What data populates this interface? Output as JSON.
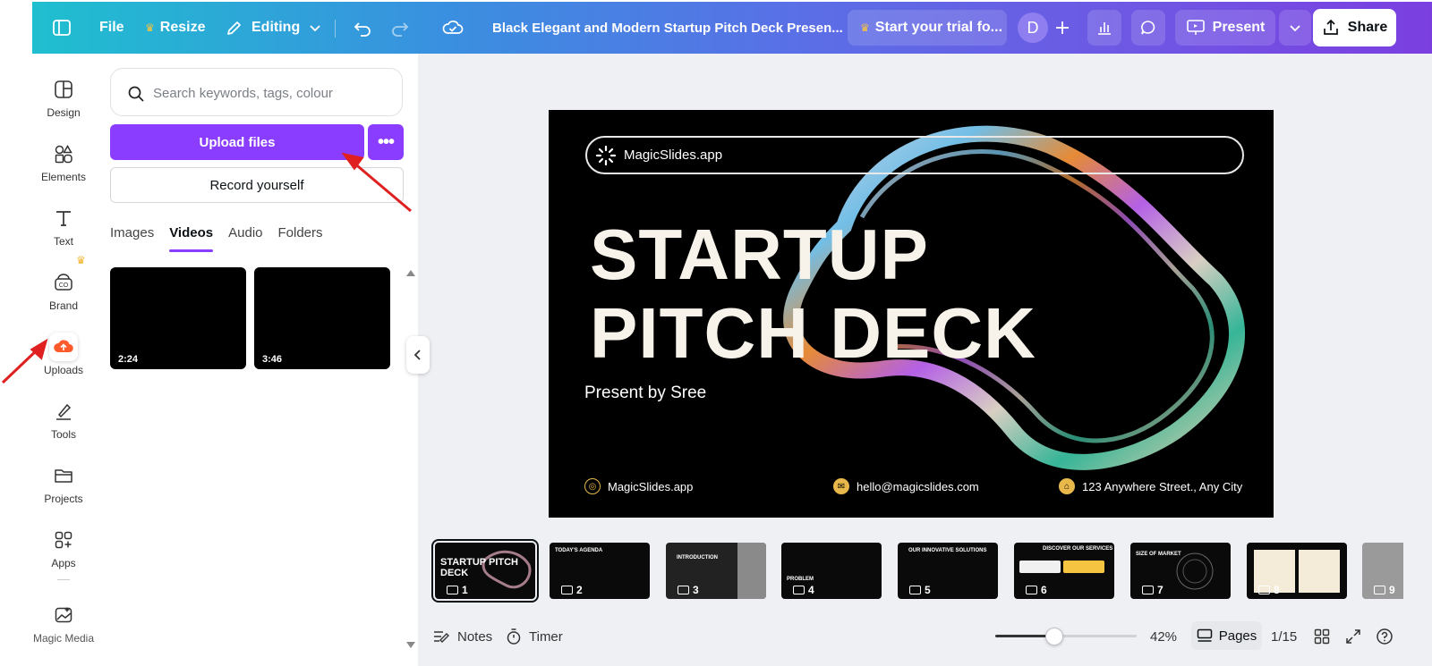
{
  "topbar": {
    "menu_icon": "sidebar-toggle-icon",
    "file_label": "File",
    "resize_label": "Resize",
    "editing_label": "Editing",
    "doc_title": "Black Elegant and Modern Startup Pitch Deck Presen...",
    "trial_label": "Start your trial fo...",
    "avatar_letter": "D",
    "present_label": "Present",
    "share_label": "Share"
  },
  "rail": {
    "items": [
      {
        "label": "Design",
        "icon": "design-icon"
      },
      {
        "label": "Elements",
        "icon": "elements-icon"
      },
      {
        "label": "Text",
        "icon": "text-icon"
      },
      {
        "label": "Brand",
        "icon": "brand-icon"
      },
      {
        "label": "Uploads",
        "icon": "uploads-icon"
      },
      {
        "label": "Tools",
        "icon": "tools-icon"
      },
      {
        "label": "Projects",
        "icon": "projects-icon"
      },
      {
        "label": "Apps",
        "icon": "apps-icon"
      },
      {
        "label": "Magic Media",
        "icon": "magic-media-icon"
      }
    ]
  },
  "panel": {
    "search_placeholder": "Search keywords, tags, colour",
    "upload_label": "Upload files",
    "more_label": "•••",
    "record_label": "Record yourself",
    "tabs": [
      "Images",
      "Videos",
      "Audio",
      "Folders"
    ],
    "active_tab": "Videos",
    "videos": [
      {
        "duration": "2:24"
      },
      {
        "duration": "3:46"
      }
    ]
  },
  "slide": {
    "brand": "MagicSlides.app",
    "title_line1": "STARTUP",
    "title_line2": "PITCH DECK",
    "subtitle": "Present by Sree",
    "footer_web": "MagicSlides.app",
    "footer_email": "hello@magicslides.com",
    "footer_address": "123 Anywhere Street., Any City"
  },
  "thumbnails": [
    {
      "num": "1",
      "title": "STARTUP PITCH DECK"
    },
    {
      "num": "2",
      "title": "TODAY'S AGENDA"
    },
    {
      "num": "3",
      "title": "INTRODUCTION"
    },
    {
      "num": "4",
      "title": "PROBLEM"
    },
    {
      "num": "5",
      "title": "OUR INNOVATIVE SOLUTIONS"
    },
    {
      "num": "6",
      "title": "DISCOVER OUR SERVICES"
    },
    {
      "num": "7",
      "title": "SIZE OF MARKET"
    },
    {
      "num": "8",
      "title": ""
    },
    {
      "num": "9",
      "title": ""
    }
  ],
  "bottombar": {
    "notes_label": "Notes",
    "timer_label": "Timer",
    "zoom": "42%",
    "zoom_fraction": 0.42,
    "pages_label": "Pages",
    "page_indicator": "1/15"
  },
  "colors": {
    "accent": "#8b3dff",
    "topbar_start": "#1fbfcf",
    "topbar_end": "#7b3fe0",
    "annotation_arrow": "#e02020",
    "slide_gold": "#e8b94a"
  }
}
